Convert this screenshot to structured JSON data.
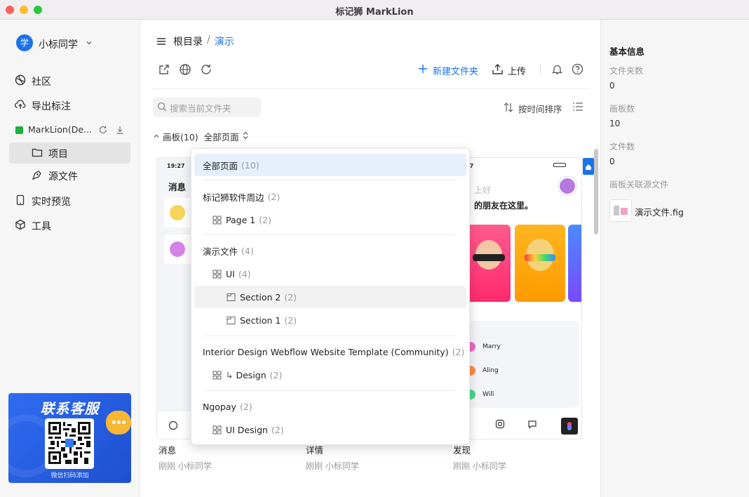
{
  "window": {
    "title": "标记狮 MarkLion"
  },
  "user": {
    "avatar_char": "学",
    "name": "小标同学"
  },
  "sidebar": {
    "nav": [
      {
        "label": "社区"
      },
      {
        "label": "导出标注"
      }
    ],
    "project_name": "MarkLion(De...",
    "sub": [
      {
        "label": "项目"
      },
      {
        "label": "源文件"
      }
    ],
    "nav2": [
      {
        "label": "实时预览"
      },
      {
        "label": "工具"
      }
    ],
    "promo": {
      "title": "联系客服",
      "caption": "微信扫码添加"
    }
  },
  "breadcrumb": {
    "root": "根目录",
    "sep": "/",
    "current": "演示"
  },
  "toolbar": {
    "new_folder": "新建文件夹",
    "upload": "上传"
  },
  "search": {
    "placeholder": "搜索当前文件夹"
  },
  "sort": {
    "label": "按时间排序"
  },
  "boards": {
    "label": "画板(10)",
    "filter": "全部页面"
  },
  "dropdown": {
    "items": [
      {
        "label": "全部页面",
        "count": "(10)"
      },
      {
        "label": "标记狮软件周边",
        "count": "(2)"
      },
      {
        "label": "Page 1",
        "count": "(2)"
      },
      {
        "label": "演示文件",
        "count": "(4)"
      },
      {
        "label": "UI",
        "count": "(4)"
      },
      {
        "label": "Section 2",
        "count": "(2)"
      },
      {
        "label": "Section 1",
        "count": "(2)"
      },
      {
        "label": "Interior Design Webflow Website Template (Community)",
        "count": "(2)"
      },
      {
        "label": "Design",
        "count": "(2)"
      },
      {
        "label": "Ngopay",
        "count": "(2)"
      },
      {
        "label": "UI Design",
        "count": "(2)"
      }
    ]
  },
  "cards": [
    {
      "name": "消息",
      "meta": "刚刚 小标同学",
      "time": "19:27",
      "heading": "消息"
    },
    {
      "name": "详情",
      "meta": "刚刚 小标同学"
    },
    {
      "name": "发现",
      "meta": "刚刚 小标同学",
      "time": "27",
      "greet": "上好",
      "tagline": "的朋友在这里。",
      "people": [
        "Marry",
        "Aling",
        "Will"
      ]
    }
  ],
  "info": {
    "title": "基本信息",
    "folder_label": "文件夹数",
    "folder_val": "0",
    "board_label": "画板数",
    "board_val": "10",
    "file_label": "文件数",
    "file_val": "0",
    "source_label": "画板关联源文件",
    "source_file": "演示文件.fig"
  }
}
